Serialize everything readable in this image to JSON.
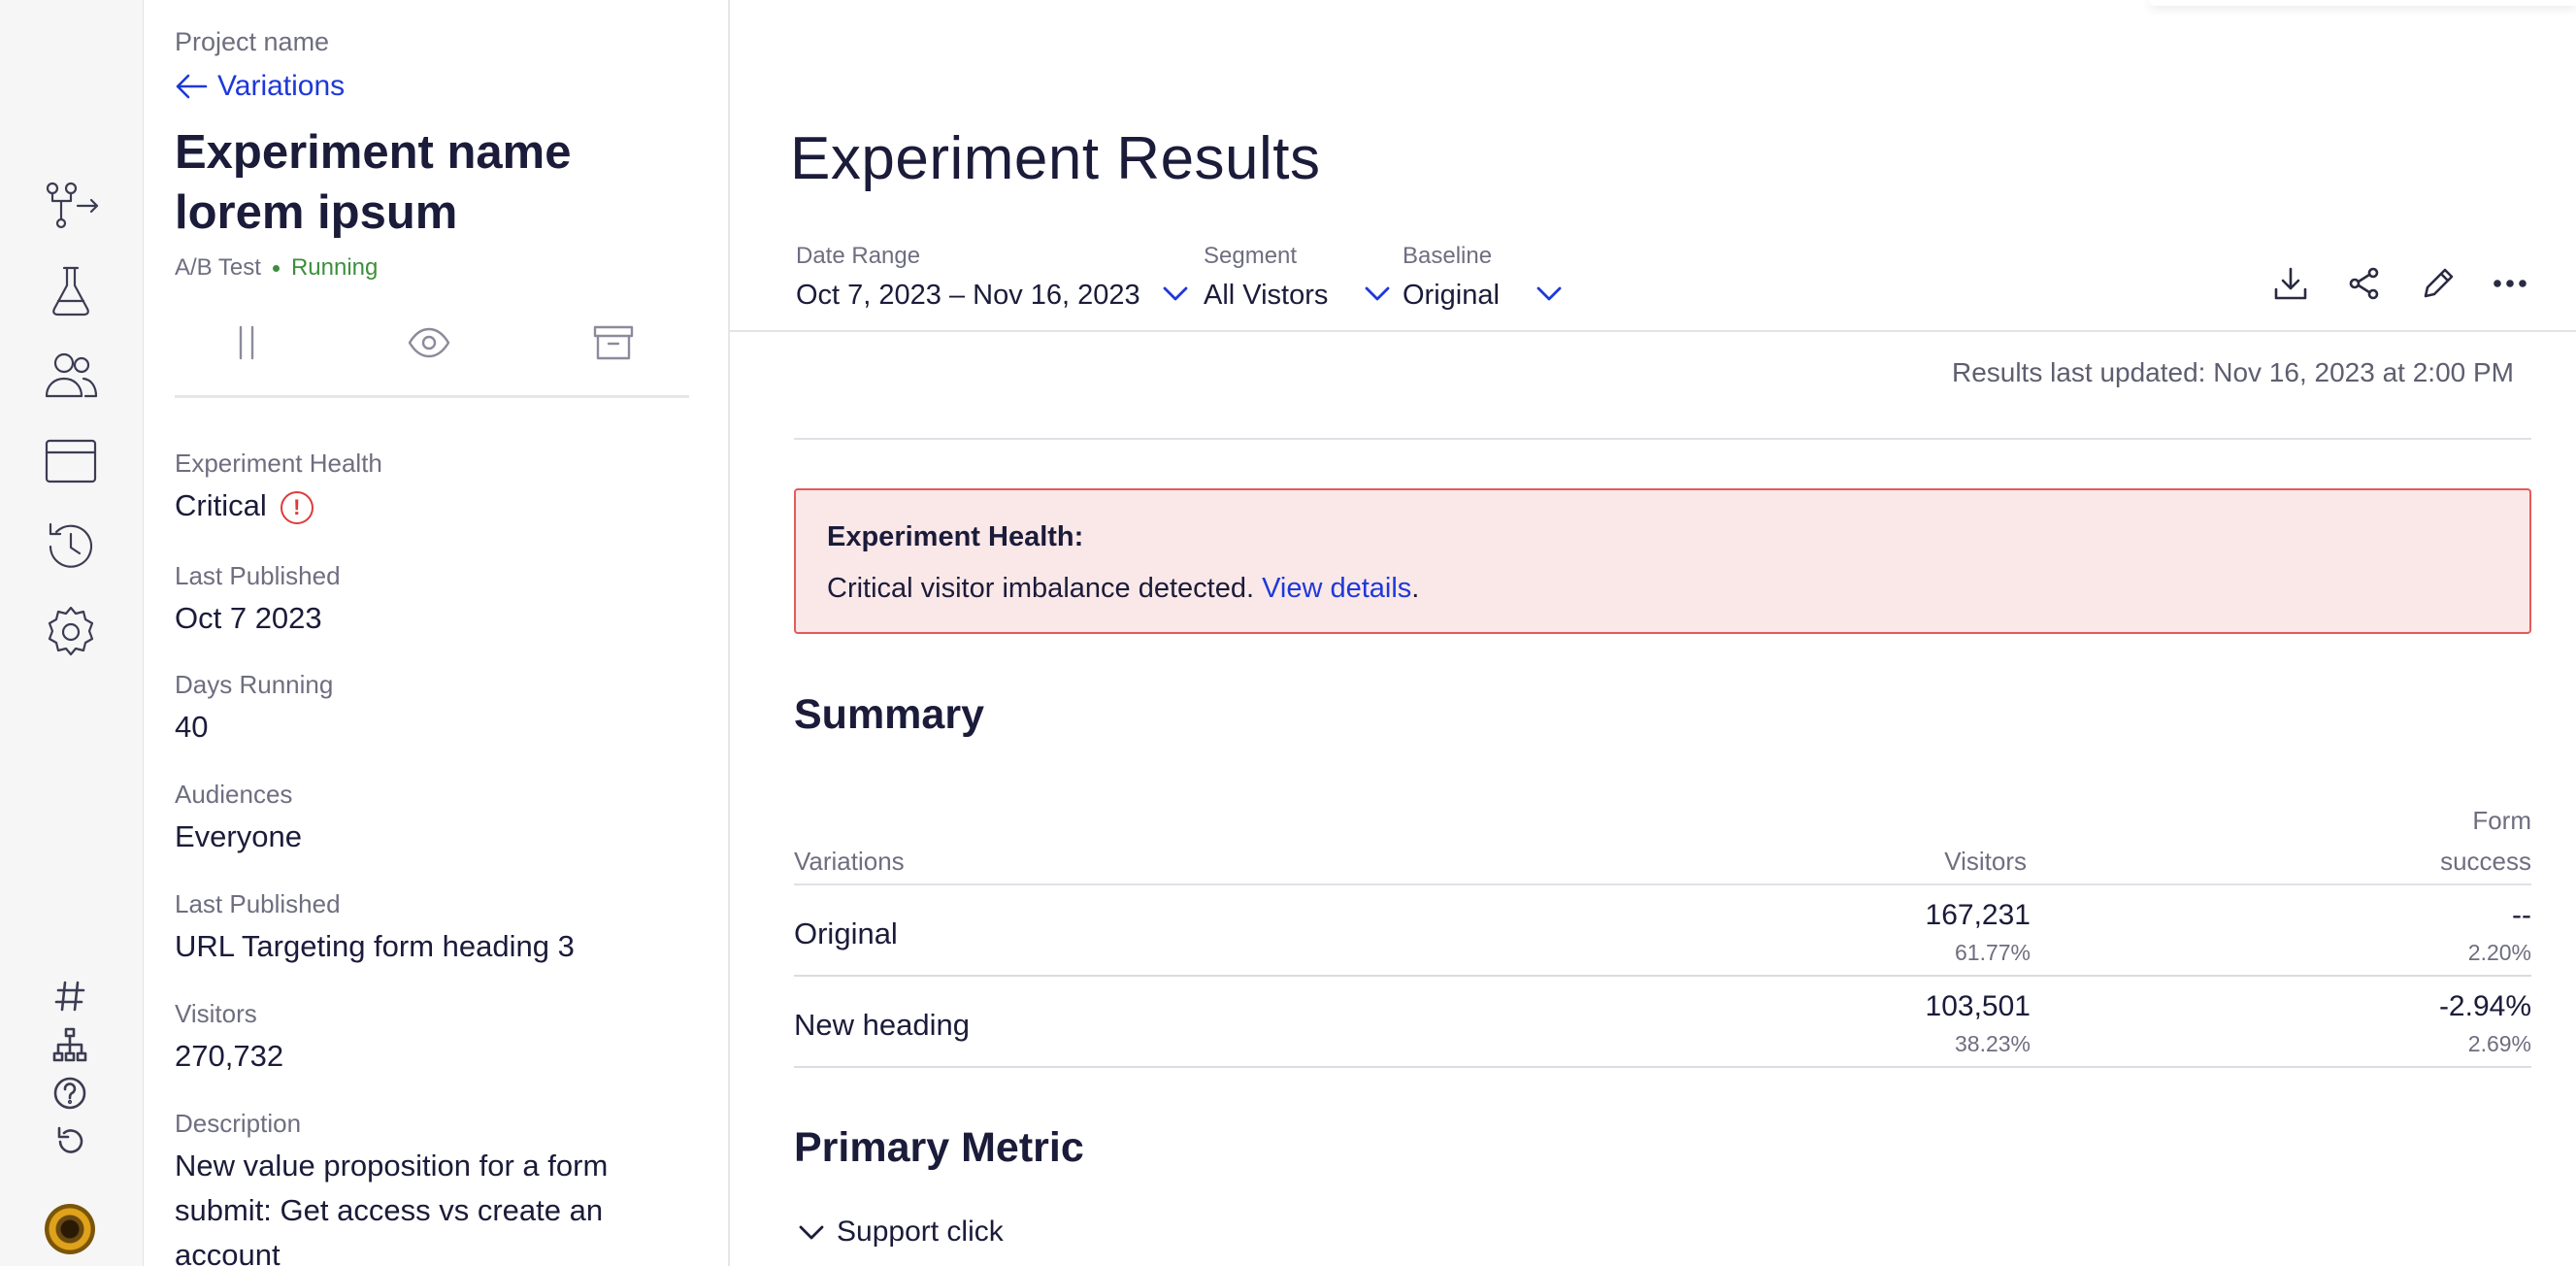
{
  "sidebar_rail": {
    "icons": [
      "branch-flow-icon",
      "flask-icon",
      "users-icon",
      "browser-window-icon",
      "history-icon",
      "settings-gear-icon"
    ],
    "bottom_icons": [
      "hash-icon",
      "sitemap-icon",
      "help-icon",
      "undo-icon"
    ],
    "avatar": "user-avatar"
  },
  "experiment": {
    "project_label": "Project name",
    "back_label": "Variations",
    "name": "Experiment name lorem ipsum",
    "type": "A/B Test",
    "status": "Running",
    "status_color": "#3d8f3d",
    "fields": {
      "health_label": "Experiment Health",
      "health_value": "Critical",
      "health_icon": "!",
      "last_published_label": "Last Published",
      "last_published_value": "Oct 7 2023",
      "days_running_label": "Days Running",
      "days_running_value": "40",
      "audiences_label": "Audiences",
      "audiences_value": "Everyone",
      "last_published_2_label": "Last Published",
      "last_published_2_value": "URL Targeting form heading 3",
      "visitors_label": "Visitors",
      "visitors_value": "270,732",
      "description_label": "Description",
      "description_value": "New value proposition for a form submit: Get access vs create an account"
    }
  },
  "main": {
    "title": "Experiment Results",
    "filters": {
      "date_range_label": "Date Range",
      "date_range_value": "Oct 7, 2023 – Nov 16, 2023",
      "segment_label": "Segment",
      "segment_value": "All Vistors",
      "baseline_label": "Baseline",
      "baseline_value": "Original"
    },
    "tools": [
      "download-icon",
      "share-icon",
      "edit-pencil-icon",
      "more-icon"
    ],
    "updated": "Results last updated: Nov 16, 2023 at 2:00 PM",
    "alert": {
      "title": "Experiment Health:",
      "text": "Critical visitor imbalance detected.",
      "link": "View details",
      "period": ".",
      "bg_color": "#fae8e8",
      "border_color": "#e35a5a"
    },
    "summary": {
      "title": "Summary",
      "col_variations": "Variations",
      "col_visitors": "Visitors",
      "col_form_1": "Form",
      "col_form_2": "success",
      "rows": [
        {
          "name": "Original",
          "visitors": "167,231",
          "visitors_pct": "61.77%",
          "form": "--",
          "form_pct": "2.20%"
        },
        {
          "name": "New heading",
          "visitors": "103,501",
          "visitors_pct": "38.23%",
          "form": "-2.94%",
          "form_pct": "2.69%"
        }
      ]
    },
    "primary_metric": {
      "title": "Primary Metric",
      "item": "Support click"
    },
    "accent_color": "#1e38d9"
  }
}
